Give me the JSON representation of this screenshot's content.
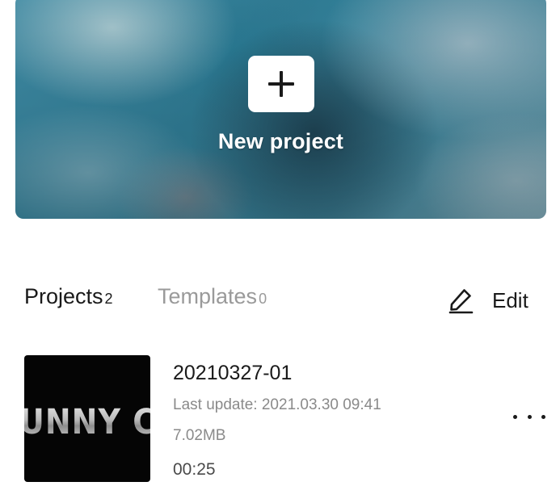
{
  "hero": {
    "new_project_label": "New project",
    "plus_icon": "plus-icon"
  },
  "tabs": [
    {
      "label": "Projects",
      "count": "2",
      "active": true
    },
    {
      "label": "Templates",
      "count": "0",
      "active": false
    }
  ],
  "edit": {
    "label": "Edit",
    "icon": "pencil-icon"
  },
  "projects": [
    {
      "thumbnail_text": "UNNY CAT",
      "title": "20210327-01",
      "last_update": "Last update: 2021.03.30 09:41",
      "size": "7.02MB",
      "duration": "00:25",
      "more_icon": "more-horizontal-icon"
    }
  ],
  "colors": {
    "active_tab": "#1a1a1a",
    "inactive_tab": "#9a9a9a",
    "meta_text": "#8a8a8a"
  }
}
